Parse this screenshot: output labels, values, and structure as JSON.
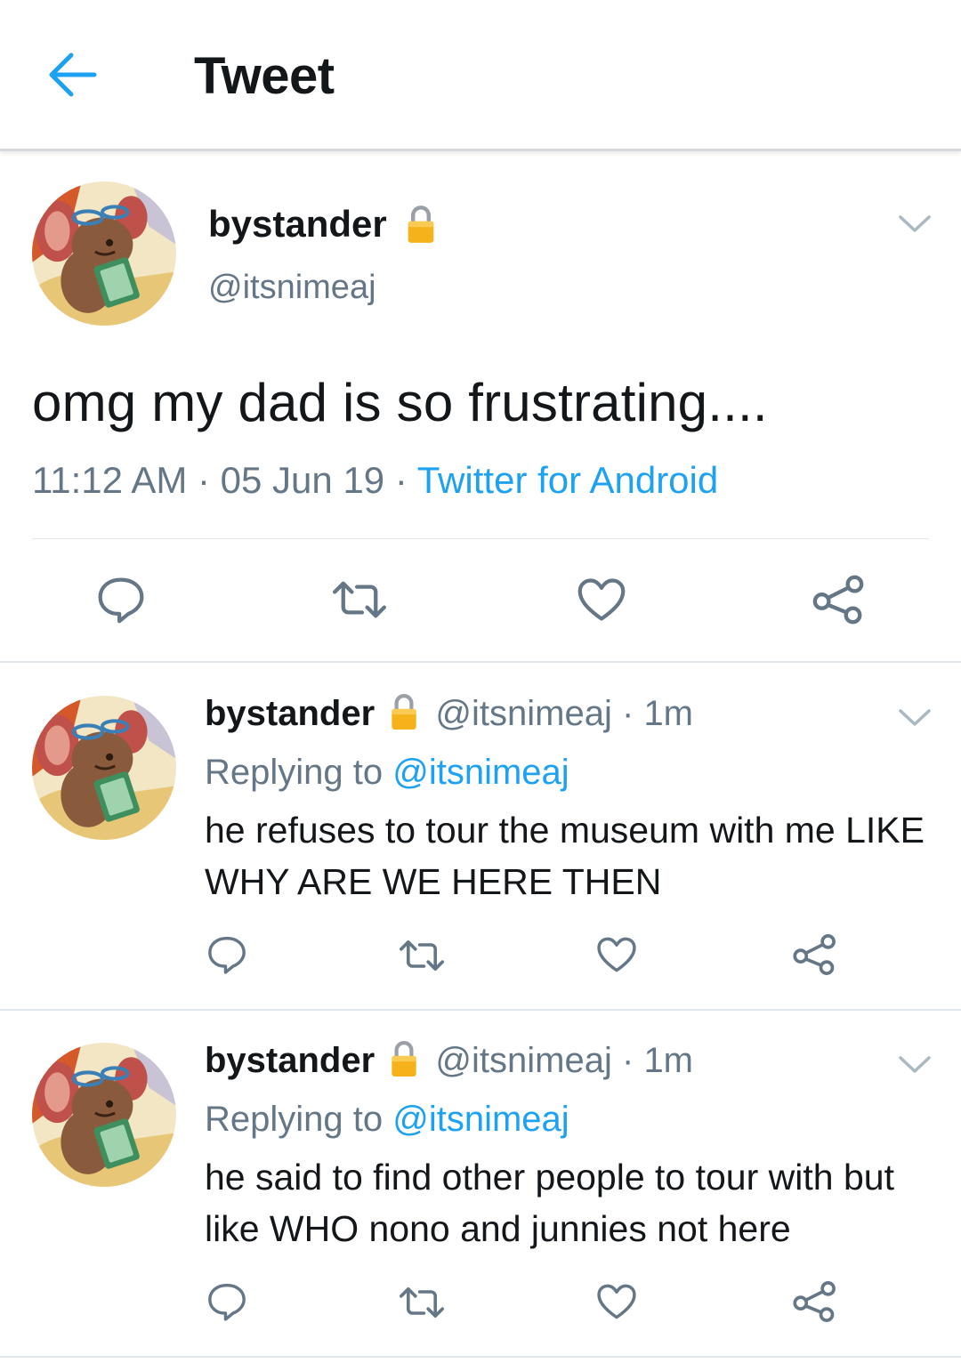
{
  "header": {
    "title": "Tweet"
  },
  "colors": {
    "accent": "#1da1f2",
    "text": "#14171a",
    "muted": "#657786",
    "lock": "#f5b21b",
    "divider": "#e1e8ed"
  },
  "main_tweet": {
    "name": "bystander",
    "handle": "@itsnimeaj",
    "text": "omg my dad is so frustrating....",
    "time": "11:12 AM",
    "date": "05 Jun 19",
    "separator": " · ",
    "source": "Twitter for Android"
  },
  "replies": [
    {
      "name": "bystander",
      "handle": "@itsnimeaj",
      "age": "1m",
      "replying_label": "Replying to",
      "replying_to": "@itsnimeaj",
      "text": "he refuses to tour the museum with me LIKE WHY ARE WE HERE THEN"
    },
    {
      "name": "bystander",
      "handle": "@itsnimeaj",
      "age": "1m",
      "replying_label": "Replying to",
      "replying_to": "@itsnimeaj",
      "text": "he said to find other people to tour with but like WHO nono and junnies not here"
    }
  ],
  "icons": [
    "back-arrow-icon",
    "lock-icon",
    "chevron-down-icon",
    "reply-icon",
    "retweet-icon",
    "like-icon",
    "share-icon"
  ]
}
